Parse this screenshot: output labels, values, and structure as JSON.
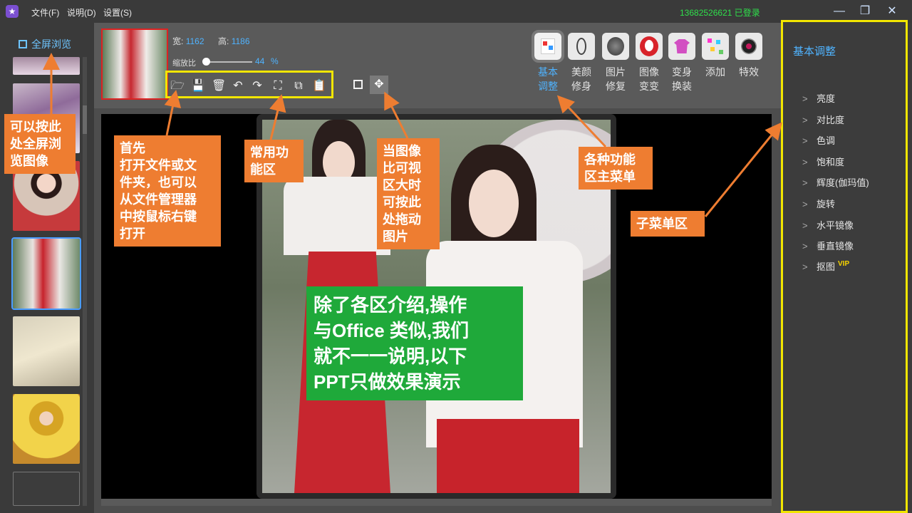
{
  "titlebar": {
    "menu": [
      "文件(F)",
      "说明(D)",
      "设置(S)"
    ],
    "user_status": "13682526621 已登录",
    "window_controls": [
      "minimize-icon",
      "restore-icon",
      "close-icon"
    ]
  },
  "left": {
    "fullscreen_label": "全屏浏览"
  },
  "image_info": {
    "width_label": "宽:",
    "width_value": "1162",
    "height_label": "高:",
    "height_value": "1186",
    "zoom_label": "缩放比",
    "zoom_value": "44",
    "zoom_unit": "%",
    "zoom_level": 0.44
  },
  "toolbar_icons": [
    "open-folder-icon",
    "save-icon",
    "delete-icon",
    "undo-icon",
    "redo-icon",
    "crop-icon",
    "copy-icon",
    "paste-icon"
  ],
  "functions": [
    {
      "line1": "基本",
      "line2": "调整",
      "active": true
    },
    {
      "line1": "美颜",
      "line2": "修身"
    },
    {
      "line1": "图片",
      "line2": "修复"
    },
    {
      "line1": "图像",
      "line2": "变变"
    },
    {
      "line1": "变身",
      "line2": "换装"
    },
    {
      "line1": "添加",
      "line2": ""
    },
    {
      "line1": "特效",
      "line2": ""
    }
  ],
  "right": {
    "title": "基本调整",
    "items": [
      "亮度",
      "对比度",
      "色调",
      "饱和度",
      "辉度(伽玛值)",
      "旋转",
      "水平镜像",
      "垂直镜像",
      "抠图"
    ],
    "vip_badge": "VIP"
  },
  "callouts": {
    "fullscreen": "可以按此\n处全屏浏\n览图像",
    "open": "首先\n打开文件或文\n件夹，也可以\n从文件管理器\n中按鼠标右键\n打开",
    "common": "常用功\n能区",
    "drag": "当图像\n比可视\n区大时\n可按此\n处拖动\n图片",
    "menu": "各种功能\n区主菜单",
    "submenu": "子菜单区",
    "summary": "除了各区介绍,操作\n与Office 类似,我们\n就不一一说明,以下\nPPT只做效果演示"
  },
  "colors": {
    "accent_blue": "#4fb3ff",
    "highlight_yellow": "#f2e600",
    "callout_orange": "#ee7d31",
    "callout_green": "#1fa93a",
    "status_green": "#2fe04b"
  }
}
